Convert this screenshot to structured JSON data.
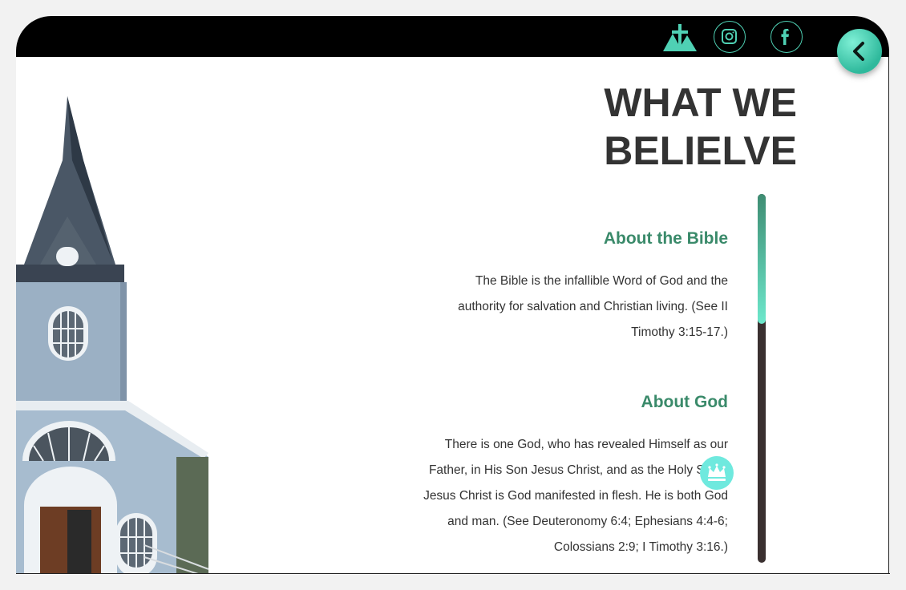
{
  "nav": {
    "logo_icon": "church-cross-logo-icon",
    "instagram_icon": "instagram-icon",
    "facebook_icon": "facebook-icon",
    "back_icon": "chevron-left-icon",
    "accent_color": "#4fd1b4"
  },
  "page": {
    "title_line1": "WHAT WE",
    "title_line2": "BELIELVE"
  },
  "sections": [
    {
      "heading": "About the Bible",
      "body": "The Bible is the infallible Word of God and the authority for salvation and Christian living. (See II Timothy 3:15-17.)"
    },
    {
      "heading": "About God",
      "body": "There is one God, who has revealed Himself as our Father, in His Son Jesus Christ, and as the Holy Spirit. Jesus Christ is God manifested in flesh. He is both God and man. (See Deuteronomy 6:4; Ephesians 4:4-6; Colossians 2:9; I Timothy 3:16.)"
    }
  ],
  "floating": {
    "crown_icon": "crown-icon"
  },
  "colors": {
    "heading_green": "#3a8a6a",
    "text_dark": "#333333",
    "crown_bg": "#6fe9de"
  }
}
